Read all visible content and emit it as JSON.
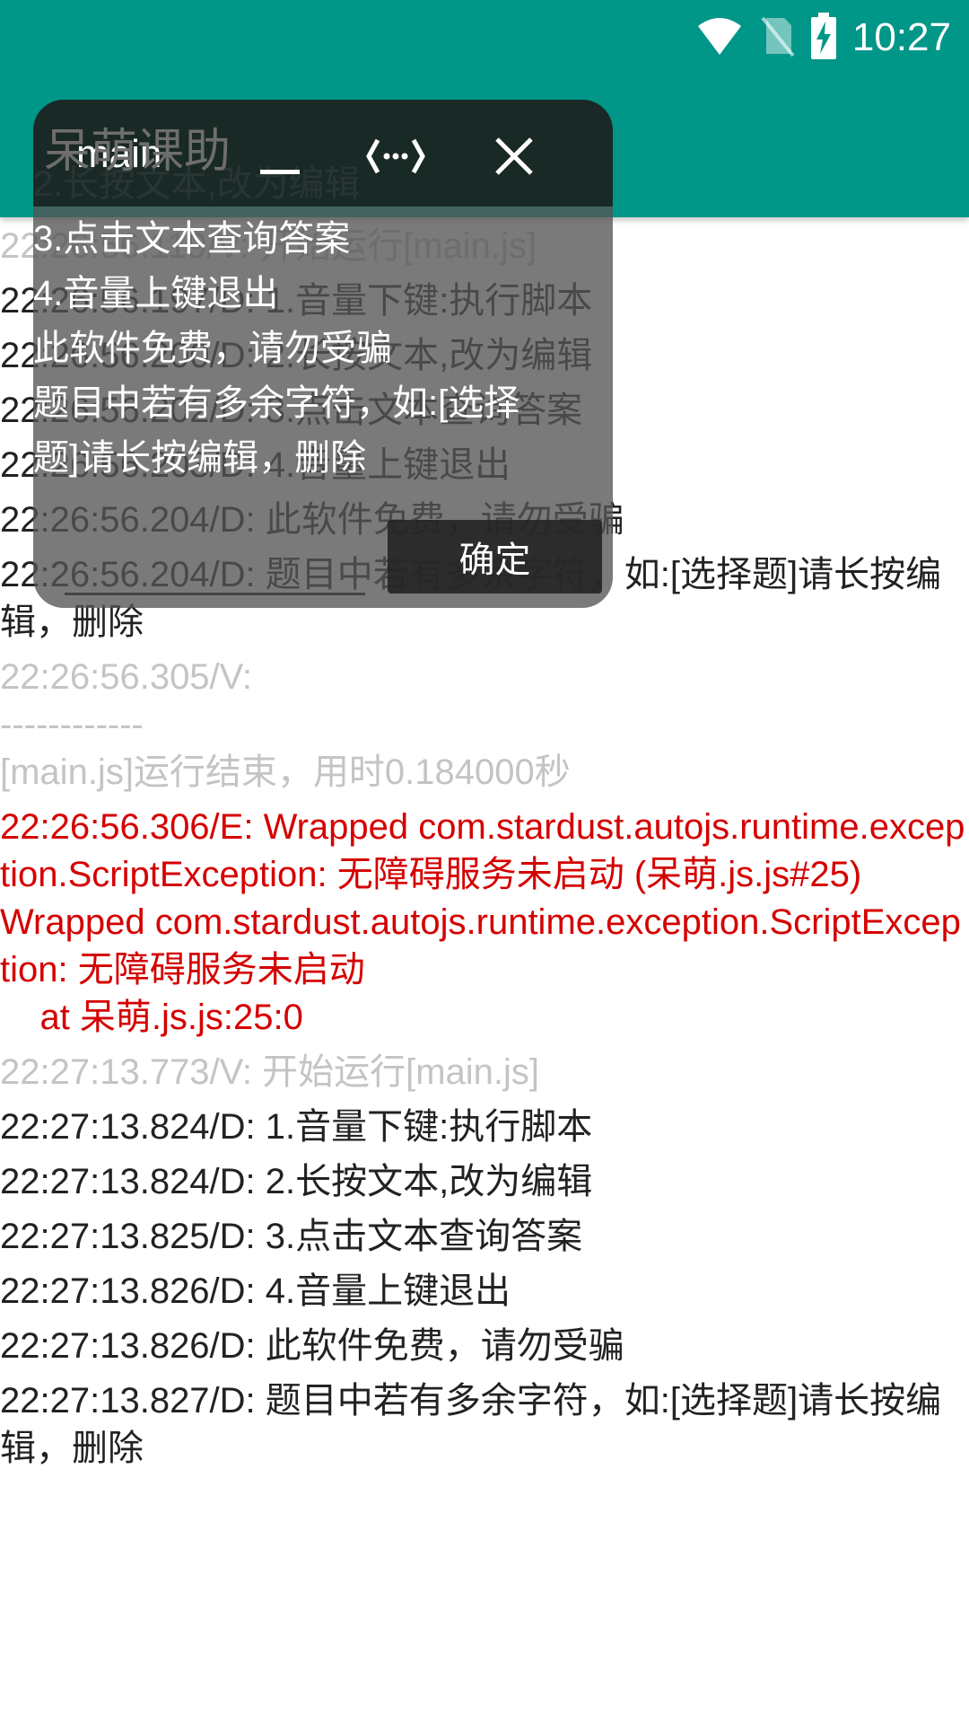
{
  "status_bar": {
    "time": "10:27",
    "icons": [
      "wifi-icon",
      "no-sim-icon",
      "battery-charging-icon"
    ]
  },
  "app_bar": {
    "title": "呆萌课助"
  },
  "colors": {
    "primary": "#009688",
    "verbose": "#c4c4c4",
    "debug": "#222222",
    "error": "#d50000"
  },
  "log": [
    {
      "level": "V",
      "text": "22:26:56.119/V: 开始运行[main.js]"
    },
    {
      "level": "D",
      "text": "22:26:56.197/D: 1.音量下键:执行脚本"
    },
    {
      "level": "D",
      "text": "22:26:56.200/D: 2.长按文本,改为编辑"
    },
    {
      "level": "D",
      "text": "22:26:56.202/D: 3.点击文本查询答案"
    },
    {
      "level": "D",
      "text": "22:26:56.203/D: 4.音量上键退出"
    },
    {
      "level": "D",
      "text": "22:26:56.204/D: 此软件免费，请勿受骗"
    },
    {
      "level": "D",
      "text": "22:26:56.204/D: 题目中若有多余字符，如:[选择题]请长按编辑，删除"
    },
    {
      "level": "V",
      "text": "22:26:56.305/V: \n------------\n[main.js]运行结束，用时0.184000秒"
    },
    {
      "level": "E",
      "text": "22:26:56.306/E: Wrapped com.stardust.autojs.runtime.exception.ScriptException: 无障碍服务未启动 (呆萌.js.js#25)\nWrapped com.stardust.autojs.runtime.exception.ScriptException: 无障碍服务未启动\n    at 呆萌.js.js:25:0\n"
    },
    {
      "level": "V",
      "text": "22:27:13.773/V: 开始运行[main.js]"
    },
    {
      "level": "D",
      "text": "22:27:13.824/D: 1.音量下键:执行脚本"
    },
    {
      "level": "D",
      "text": "22:27:13.824/D: 2.长按文本,改为编辑"
    },
    {
      "level": "D",
      "text": "22:27:13.825/D: 3.点击文本查询答案"
    },
    {
      "level": "D",
      "text": "22:27:13.826/D: 4.音量上键退出"
    },
    {
      "level": "D",
      "text": "22:27:13.826/D: 此软件免费，请勿受骗"
    },
    {
      "level": "D",
      "text": "22:27:13.827/D: 题目中若有多余字符，如:[选择题]请长按编辑，删除"
    }
  ],
  "float_window": {
    "title": "main",
    "minimize_icon": "minimize-icon",
    "resize_icon": "resize-horizontal-icon",
    "close_icon": "close-icon",
    "lines": [
      "2.长按文本,改为编辑",
      "3.点击文本查询答案",
      "4.音量上键退出",
      "此软件免费，请勿受骗",
      "题目中若有多余字符，如:[选择",
      "题]请长按编辑，删除"
    ],
    "ok_label": "确定"
  }
}
